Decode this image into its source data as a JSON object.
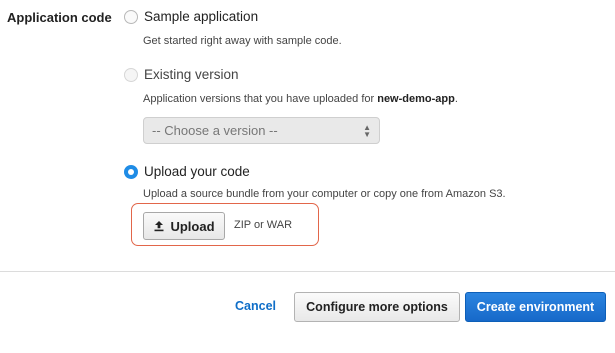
{
  "field": {
    "label": "Application code"
  },
  "options": [
    {
      "label": "Sample application",
      "help": "Get started right away with sample code.",
      "selected": false,
      "enabled": true
    },
    {
      "label": "Existing version",
      "help_prefix": "Application versions that you have uploaded for ",
      "help_app": "new-demo-app",
      "help_suffix": ".",
      "selected": false,
      "enabled": false
    },
    {
      "label": "Upload your code",
      "help": "Upload a source bundle from your computer or copy one from Amazon S3.",
      "selected": true,
      "enabled": true
    }
  ],
  "version_select": {
    "value": "-- Choose a version --",
    "enabled": false
  },
  "upload": {
    "button_label": "Upload",
    "icon": "upload-icon",
    "hint": "ZIP or WAR",
    "highlight_color": "#e2664a"
  },
  "footer": {
    "cancel_label": "Cancel",
    "configure_label": "Configure more options",
    "create_label": "Create environment",
    "primary_color": "#1769c9",
    "link_color": "#0f6ec8"
  }
}
